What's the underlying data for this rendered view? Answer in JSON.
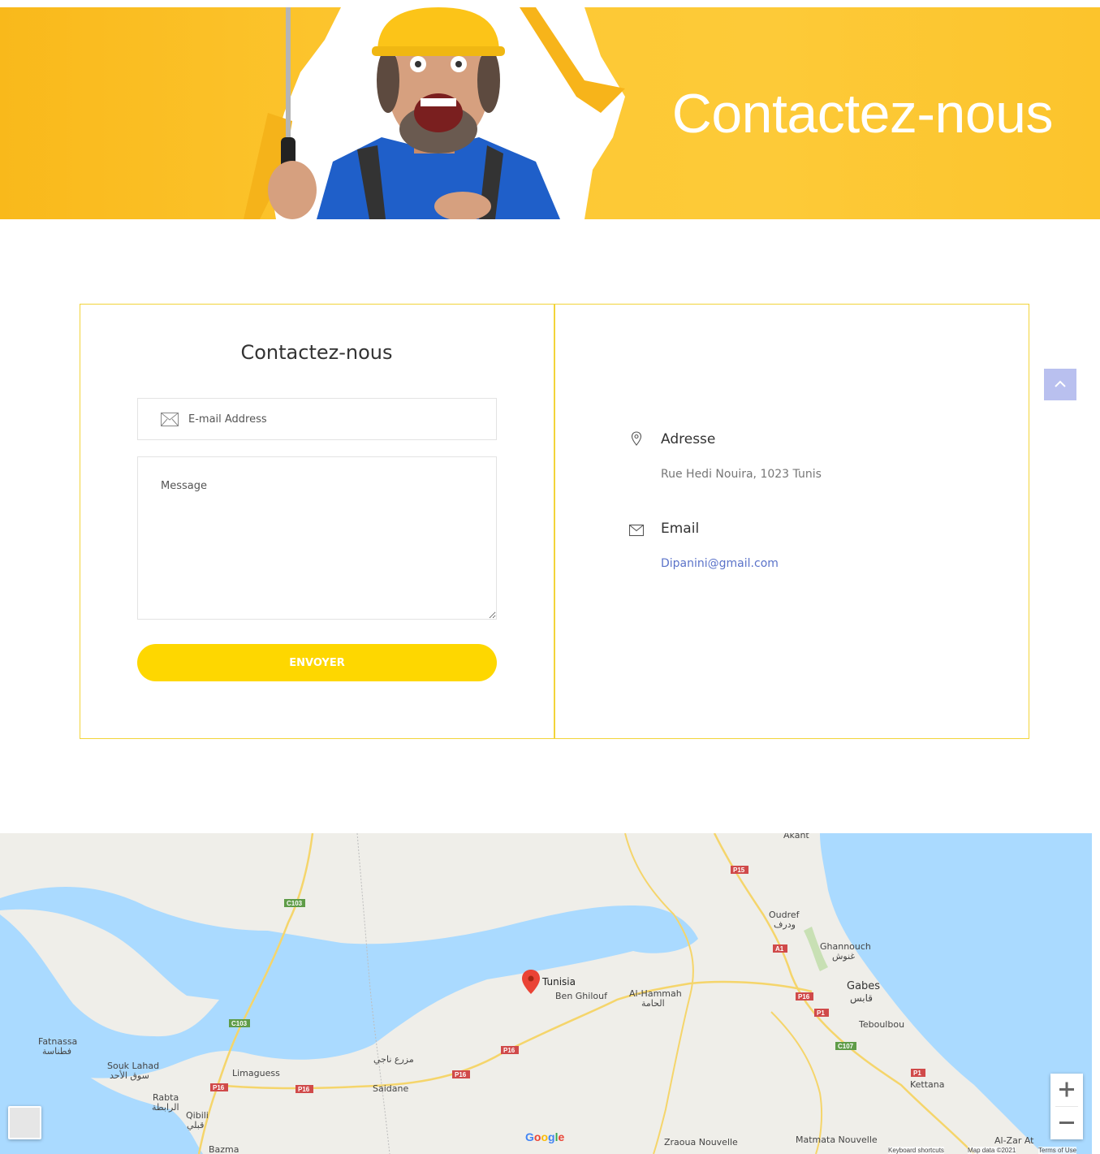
{
  "hero": {
    "title": "Contactez-nous"
  },
  "form": {
    "title": "Contactez-nous",
    "email_placeholder": "E-mail Address",
    "message_placeholder": "Message",
    "send_label": "ENVOYER"
  },
  "info": {
    "address_label": "Adresse",
    "address_value": "Rue Hedi Nouira, 1023 Tunis",
    "email_label": "Email",
    "email_value": "Dipanini@gmail.com"
  },
  "map": {
    "marker_label": "Tunisia",
    "places": [
      "Ben Ghilouf",
      "Al-Hammah",
      "الحامة",
      "Gabes",
      "قابس",
      "Oudref",
      "ودرف",
      "Ghannouch",
      "غنوش",
      "Teboulbou",
      "Kettana",
      "Fatnassa",
      "فطناسة",
      "Souk Lahad",
      "سوق الأحد",
      "Rabta",
      "الرابطة",
      "Qibili",
      "قبلي",
      "Bazma",
      "Limaguess",
      "Saidane",
      "مزرع ناجي",
      "Zraoua Nouvelle",
      "Matmata Nouvelle",
      "Al-Zar At",
      "Akant"
    ],
    "roads": [
      "C103",
      "C103",
      "P16",
      "P16",
      "P16",
      "P16",
      "P16",
      "P15",
      "A1",
      "A1",
      "P1",
      "P1",
      "C107"
    ],
    "google_label": "Google",
    "attribution_shortcuts": "Keyboard shortcuts",
    "attribution_data": "Map data ©2021",
    "attribution_terms": "Terms of Use"
  },
  "colors": {
    "accent": "#fed700",
    "hero_bg": "#fdc833",
    "border": "#f2d43a",
    "link": "#5b73c9",
    "water": "#aadaff",
    "land": "#efeee9"
  }
}
